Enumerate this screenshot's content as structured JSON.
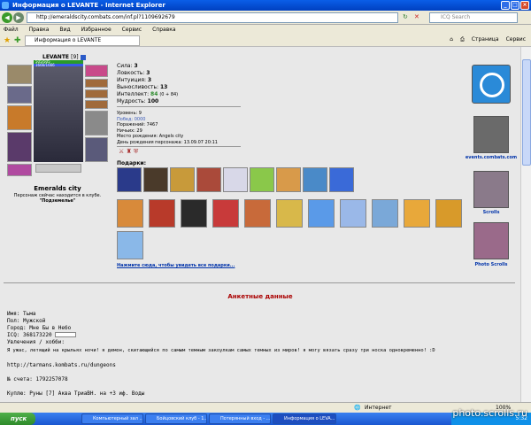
{
  "window": {
    "title": "Информация о LEVANTE - Internet Explorer",
    "btn_min": "_",
    "btn_max": "□",
    "btn_close": "×"
  },
  "address": {
    "url": "http://emeraldscity.combats.com/inf.pl?1109692679",
    "search_placeholder": "ICQ Search"
  },
  "menu": [
    "Файл",
    "Правка",
    "Вид",
    "Избранное",
    "Сервис",
    "Справка"
  ],
  "tab": {
    "label": "Информация о LEVANTE"
  },
  "tools": {
    "page": "Страница",
    "service": "Сервис"
  },
  "profile": {
    "name": "LEVANTE",
    "level": "[9]",
    "hp": "505/505",
    "mana": "1666/1666",
    "city": "Emeralds city",
    "club_text": "Персонаж сейчас находится в клубе.",
    "club_room": "\"Подземелье\""
  },
  "stats": [
    {
      "label": "Сила:",
      "value": "3"
    },
    {
      "label": "Ловкость:",
      "value": "3"
    },
    {
      "label": "Интуиция:",
      "value": "3"
    },
    {
      "label": "Выносливость:",
      "value": "13"
    },
    {
      "label": "Интеллект:",
      "value": "84",
      "extra": "(0 + 84)"
    },
    {
      "label": "Мудрость:",
      "value": "100"
    }
  ],
  "info": [
    "Уровень: 9",
    "Побед: 0000",
    "Поражений: 7467",
    "Ничьих: 29",
    "Место рождения: Angels city",
    "День рождения персонажа: 13.09.07 20:11"
  ],
  "gifts_label": "Подарки:",
  "gifts_more": "Нажмите сюда, чтобы увидеть все подарки...",
  "banners": [
    {
      "label": "events.combats.com"
    },
    {
      "label": "Scrolls"
    },
    {
      "label": "Photo Scrolls"
    }
  ],
  "questionnaire": {
    "title": "Анкетные данные",
    "lines": [
      "Имя: Тьма",
      "Пол: Мужской",
      "Город: Мне Бы в Небо",
      "ICQ: 368173220",
      "Увлечения / хобби:"
    ],
    "quote": "  Я ужас, летящий на крыльях ночи!  я демон, скитающийся по самым темным закоулкам самых темных из миров! я  могу вязать сразу три носка одновременно! :D",
    "link": "http://tarmans.kombats.ru/dungeons",
    "account": "№ счета: 1792257078",
    "buy": "Куплю: Руны [7] Аква ТриаВН. на +3 иф. Воды"
  },
  "status": {
    "zone": "Интернет",
    "zoom": "100%"
  },
  "taskbar": {
    "start": "пуск",
    "items": [
      "Компьютерный зал ...",
      "Бойцовский клуб - 1...",
      "Потерянный вход - ...",
      "Информация о LEVA..."
    ],
    "clock": "5:32"
  },
  "watermark": "photo.scrolls.ru"
}
